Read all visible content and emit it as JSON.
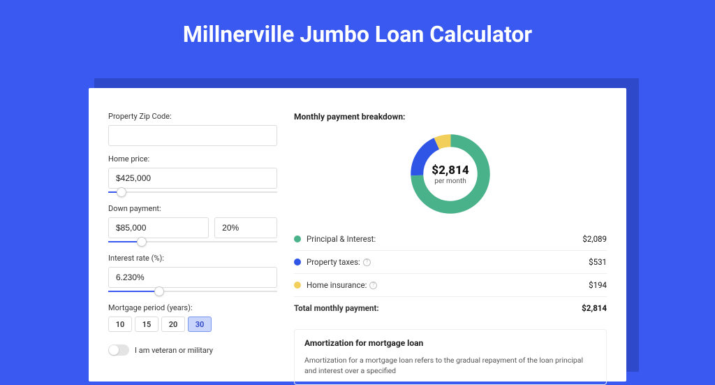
{
  "page_title": "Millnerville Jumbo Loan Calculator",
  "left": {
    "zip_label": "Property Zip Code:",
    "zip_value": "",
    "home_price_label": "Home price:",
    "home_price_value": "$425,000",
    "home_price_slider_pct": 8,
    "down_label": "Down payment:",
    "down_value": "$85,000",
    "down_pct_value": "20%",
    "down_slider_pct": 20,
    "rate_label": "Interest rate (%):",
    "rate_value": "6.230%",
    "rate_slider_pct": 30,
    "period_label": "Mortgage period (years):",
    "period_options": [
      "10",
      "15",
      "20",
      "30"
    ],
    "period_selected": "30",
    "veteran_label": "I am veteran or military"
  },
  "right": {
    "breakdown_title": "Monthly payment breakdown:",
    "donut_amount": "$2,814",
    "donut_sub": "per month",
    "rows": [
      {
        "color": "#49b28b",
        "label": "Principal & Interest:",
        "value": "$2,089",
        "info": false
      },
      {
        "color": "#2f55e6",
        "label": "Property taxes:",
        "value": "$531",
        "info": true
      },
      {
        "color": "#f2cf5b",
        "label": "Home insurance:",
        "value": "$194",
        "info": true
      }
    ],
    "total_label": "Total monthly payment:",
    "total_value": "$2,814",
    "amort_title": "Amortization for mortgage loan",
    "amort_text": "Amortization for a mortgage loan refers to the gradual repayment of the loan principal and interest over a specified"
  },
  "chart_data": {
    "type": "pie",
    "title": "Monthly payment breakdown",
    "categories": [
      "Principal & Interest",
      "Property taxes",
      "Home insurance"
    ],
    "values": [
      2089,
      531,
      194
    ],
    "colors": [
      "#49b28b",
      "#2f55e6",
      "#f2cf5b"
    ],
    "center_label": "$2,814 per month"
  }
}
